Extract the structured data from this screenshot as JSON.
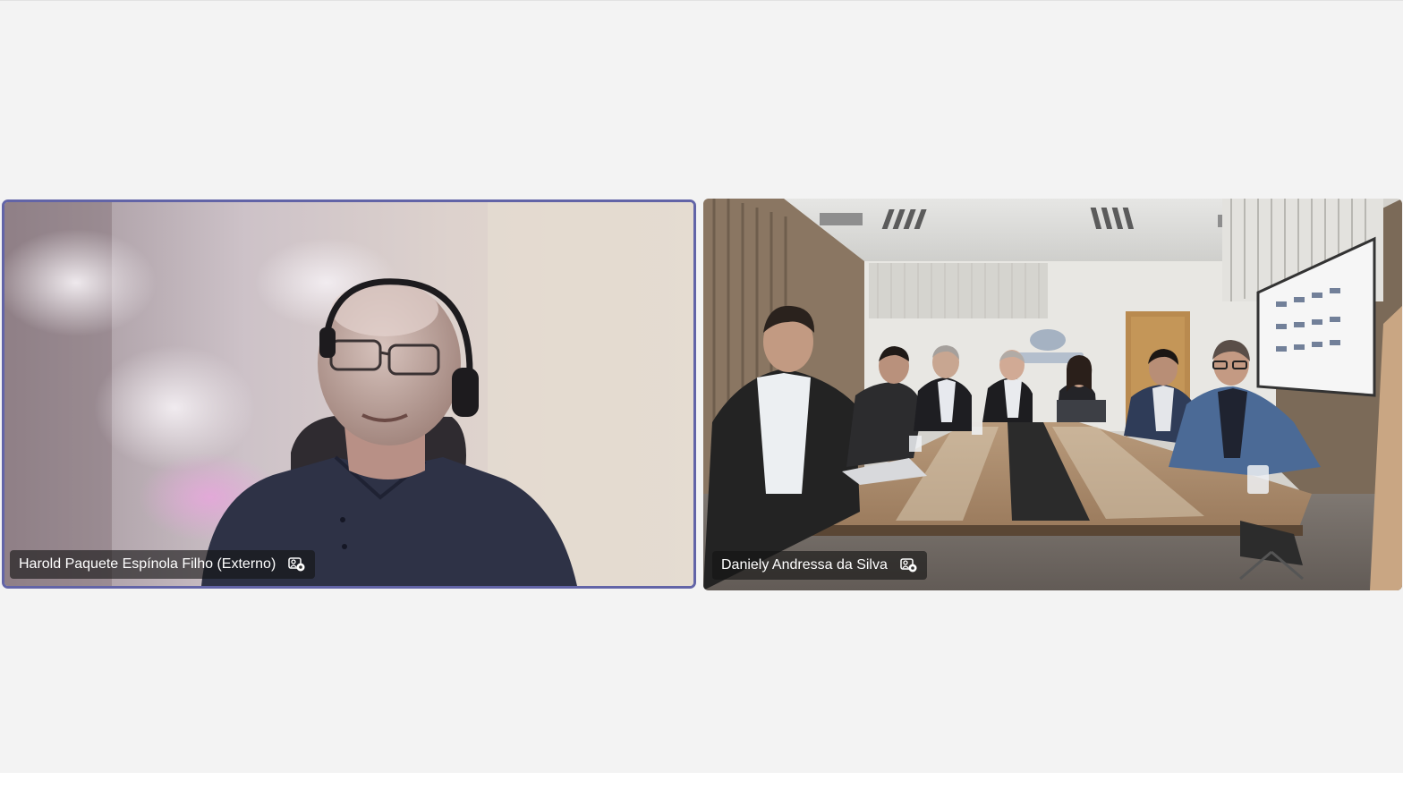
{
  "call": {
    "participants": [
      {
        "name": "Harold Paquete Espínola Filho (Externo)",
        "icon": "camera-participant-icon",
        "active_speaker": true
      },
      {
        "name": "Daniely Andressa da Silva",
        "icon": "camera-participant-icon",
        "active_speaker": false
      }
    ]
  },
  "colors": {
    "stage_bg": "#f3f3f3",
    "active_border": "#6264a7"
  }
}
